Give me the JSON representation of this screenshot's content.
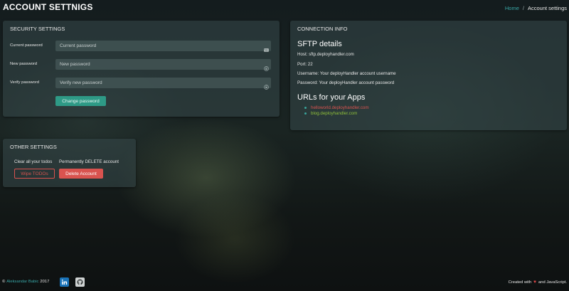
{
  "header": {
    "title": "ACCOUNT SETTNIGS",
    "breadcrumb": {
      "home": "Home",
      "separator": "/",
      "current": "Account settings"
    }
  },
  "security": {
    "title": "SECURITY SETTINGS",
    "current_password": {
      "label": "Current password",
      "placeholder": "Current password"
    },
    "new_password": {
      "label": "New password",
      "placeholder": "New password"
    },
    "verify_password": {
      "label": "Verify password",
      "placeholder": "Verify new password"
    },
    "submit_label": "Change password"
  },
  "connection": {
    "title": "CONNECTION INFO",
    "sftp_heading": "SFTP details",
    "host": "Host: sftp.deployhandler.com",
    "port": "Port: 22",
    "username": "Username: Your deployHandler account username",
    "password": "Password: Your deployHandler account password",
    "urls_heading": "URLs for your Apps",
    "urls": [
      "helloworld.deployhandler.com",
      "blog.deployhandler.com"
    ]
  },
  "other": {
    "title": "OTHER SETTINGS",
    "clear_label": "Clear all your todos",
    "delete_label": "Permanently DELETE account",
    "wipe_button": "Wipe TODOs",
    "delete_button": "Delete Account"
  },
  "footer": {
    "copyright": "©",
    "author": "Aleksandar Babic",
    "year": "2017",
    "created_prefix": "Created with",
    "created_suffix": "and JavaScript."
  },
  "colors": {
    "accent": "#38a6a6",
    "primary_button": "#2e9a86",
    "danger": "#d9534f",
    "url_green": "#8fbf3a"
  },
  "icons": [
    "keyboard-icon",
    "lock-icon",
    "lock-icon",
    "linkedin-icon",
    "github-icon",
    "heart-icon"
  ]
}
